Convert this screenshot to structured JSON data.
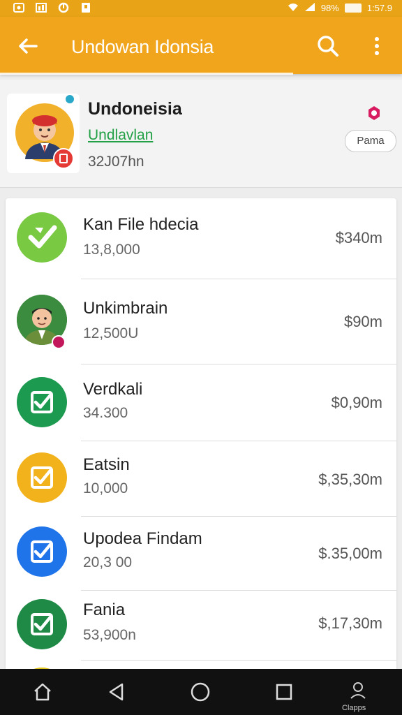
{
  "status_bar": {
    "battery": "98%",
    "time": "1:57.9"
  },
  "app_bar": {
    "title": "Undowan Idonsia",
    "back_icon": "arrow-left-icon",
    "search_icon": "search-icon",
    "more_icon": "more-vert-icon"
  },
  "profile": {
    "name": "Undoneisia",
    "subtitle": "Undlavlan",
    "stat": "32J07hn",
    "button_label": "Pama",
    "badge_color": "#d81b60"
  },
  "list": [
    {
      "name": "Kan File hdecia",
      "count": "13,8,000",
      "amount": "$340m",
      "icon": "leaf-check-icon",
      "color": "#7ac943"
    },
    {
      "name": "Unkimbrain",
      "count": "12,500U",
      "amount": "$90m",
      "icon": "avatar-icon",
      "color": "#2e7d32"
    },
    {
      "name": "Verdkali",
      "count": "34.300",
      "amount": "$0,90m",
      "icon": "checkbox-icon",
      "color": "#1b9a50"
    },
    {
      "name": "Eatsin",
      "count": "10,000",
      "amount": "$,35,30m",
      "icon": "checkbox-icon",
      "color": "#f2b21b"
    },
    {
      "name": "Upodea Findam",
      "count": "20,3 00",
      "amount": "$.35,00m",
      "icon": "checkbox-icon",
      "color": "#1e74e8"
    },
    {
      "name": "Fania",
      "count": "53,900n",
      "amount": "$,17,30m",
      "icon": "checkbox-icon",
      "color": "#1e8a46"
    }
  ],
  "nav_bar": {
    "home_icon": "home-icon",
    "back_icon": "triangle-back-icon",
    "circle_icon": "home-circle-icon",
    "recents_icon": "recents-square-icon",
    "profile_icon": "person-icon",
    "profile_label": "Clapps"
  },
  "colors": {
    "accent": "#f0a51c",
    "status_bar": "#e8a317",
    "link_green": "#22a045"
  }
}
